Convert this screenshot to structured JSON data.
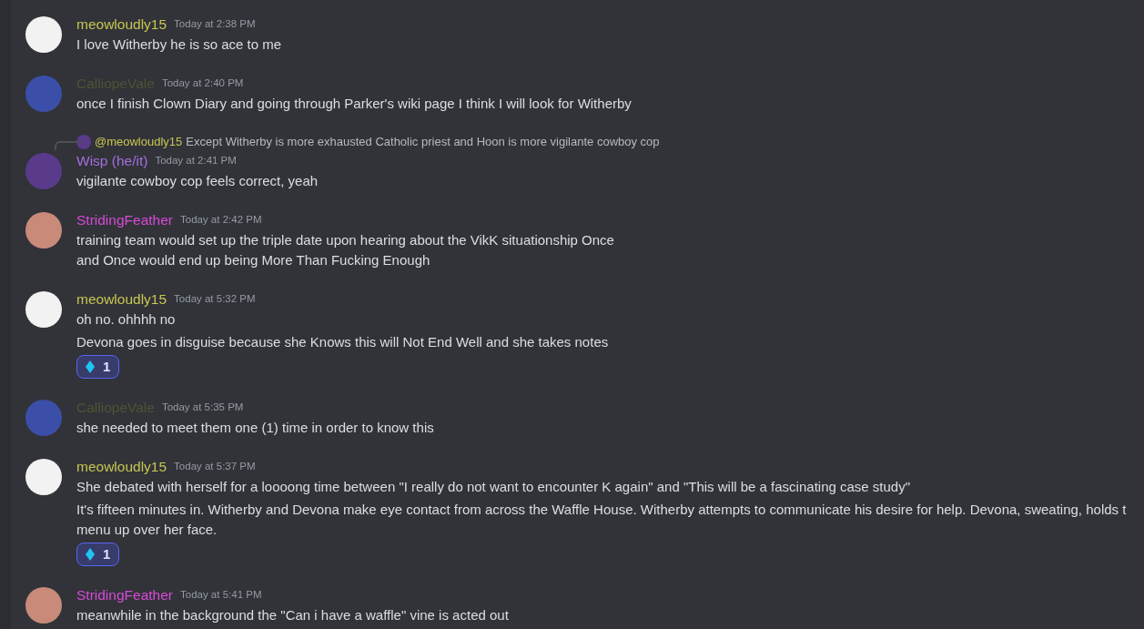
{
  "messages": [
    {
      "author": "meowloudly15",
      "color": "#c9c552",
      "avatar": {
        "color": "#f2f2f2"
      },
      "time": "Today at 2:38 PM",
      "blocks": [
        {
          "lines": [
            "I love Witherby he is so ace to me"
          ]
        }
      ]
    },
    {
      "author": "CalliopeVale",
      "color": "#4b5535",
      "avatar": {
        "color": "#3b4fa8"
      },
      "time": "Today at 2:40 PM",
      "blocks": [
        {
          "lines": [
            "once I finish Clown Diary and going through Parker's wiki page I think I will look for Witherby"
          ]
        }
      ]
    },
    {
      "author": "Wisp (he/it)",
      "color": "#a46fe0",
      "avatar": {
        "color": "#5a3a8a"
      },
      "time": "Today at 2:41 PM",
      "reply": {
        "author": "@meowloudly15",
        "color": "#c9c552",
        "text": "Except Witherby is more exhausted Catholic priest and Hoon is more vigilante cowboy cop"
      },
      "blocks": [
        {
          "lines": [
            "vigilante cowboy cop feels correct, yeah"
          ]
        }
      ]
    },
    {
      "author": "StridingFeather",
      "color": "#d84ad8",
      "avatar": {
        "color": "#c98a7a"
      },
      "time": "Today at 2:42 PM",
      "blocks": [
        {
          "lines": [
            "training team would set up the triple date upon hearing about the VikK situationship Once",
            "and Once would end up being More Than Fucking Enough"
          ]
        }
      ]
    },
    {
      "author": "meowloudly15",
      "color": "#c9c552",
      "avatar": {
        "color": "#f2f2f2"
      },
      "time": "Today at 5:32 PM",
      "blocks": [
        {
          "lines": [
            "oh no. ohhhh no"
          ]
        },
        {
          "lines": [
            "Devona goes in disguise because she Knows this will Not End Well and she takes notes"
          ],
          "reactions": [
            {
              "count": "1",
              "selected": true
            }
          ]
        }
      ]
    },
    {
      "author": "CalliopeVale",
      "color": "#4b5535",
      "avatar": {
        "color": "#3b4fa8"
      },
      "time": "Today at 5:35 PM",
      "blocks": [
        {
          "lines": [
            "she needed to meet them one (1) time in order to know this"
          ]
        }
      ]
    },
    {
      "author": "meowloudly15",
      "color": "#c9c552",
      "avatar": {
        "color": "#f2f2f2"
      },
      "time": "Today at 5:37 PM",
      "blocks": [
        {
          "lines": [
            "She debated with herself for a loooong time between \"I really do not want to encounter K again\" and \"This will be a fascinating case study\""
          ]
        },
        {
          "lines": [
            "It's fifteen minutes in. Witherby and Devona make eye contact from across the Waffle House. Witherby attempts to communicate his desire for help. Devona, sweating, holds t",
            "menu up over her face."
          ],
          "reactions": [
            {
              "count": "1",
              "selected": true
            }
          ]
        }
      ]
    },
    {
      "author": "StridingFeather",
      "color": "#d84ad8",
      "avatar": {
        "color": "#c98a7a"
      },
      "time": "Today at 5:41 PM",
      "blocks": [
        {
          "lines": [
            "meanwhile in the background the \"Can i have a waffle\" vine is acted out"
          ]
        }
      ]
    }
  ]
}
